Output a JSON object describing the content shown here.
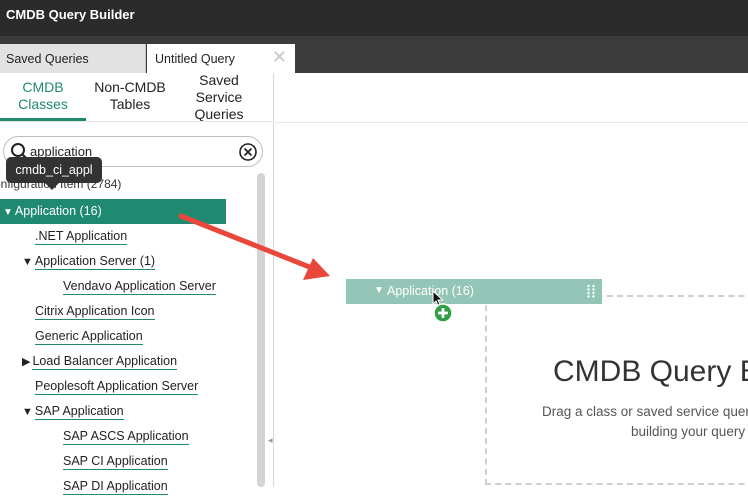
{
  "app": {
    "title": "CMDB Query Builder"
  },
  "tabs": [
    {
      "label": "Saved Queries"
    },
    {
      "label": "Untitled Query",
      "close_glyph": "✕"
    }
  ],
  "subtabs": [
    {
      "label": "CMDB\nClasses"
    },
    {
      "label": "Non-CMDB\nTables"
    },
    {
      "label": "Saved\nService\nQueries"
    }
  ],
  "search": {
    "value": "application",
    "icon": "search-icon",
    "clear_icon": "clear-icon"
  },
  "tooltip": {
    "text": "cmdb_ci_appl"
  },
  "tree": {
    "config_item": "onfiguration Item (2784)",
    "selected": "Application (16)",
    "children": [
      {
        "label": ".NET Application",
        "level": 1,
        "expander": ""
      },
      {
        "label": "Application Server (1)",
        "level": 1,
        "expander": "down"
      },
      {
        "label": "Vendavo Application Server",
        "level": 2,
        "expander": ""
      },
      {
        "label": "Citrix Application Icon",
        "level": 1,
        "expander": ""
      },
      {
        "label": "Generic Application",
        "level": 1,
        "expander": ""
      },
      {
        "label": "Load Balancer Application",
        "level": 1,
        "expander": "right"
      },
      {
        "label": "Peoplesoft Application Server",
        "level": 1,
        "expander": ""
      },
      {
        "label": "SAP Application",
        "level": 1,
        "expander": "down"
      },
      {
        "label": "SAP ASCS Application",
        "level": 2,
        "expander": ""
      },
      {
        "label": "SAP CI Application",
        "level": 2,
        "expander": ""
      },
      {
        "label": "SAP DI Application",
        "level": 2,
        "expander": ""
      }
    ]
  },
  "drag": {
    "label": "Application (16)"
  },
  "canvas": {
    "title": "CMDB Query B",
    "subtitle_line1": "Drag a class or saved service quer",
    "subtitle_line2": "building your query"
  },
  "colors": {
    "accent": "#1f8a70",
    "annotation_arrow": "#e8473a",
    "drag_ghost": "#8fc4b5",
    "plus": "#2ea043"
  }
}
